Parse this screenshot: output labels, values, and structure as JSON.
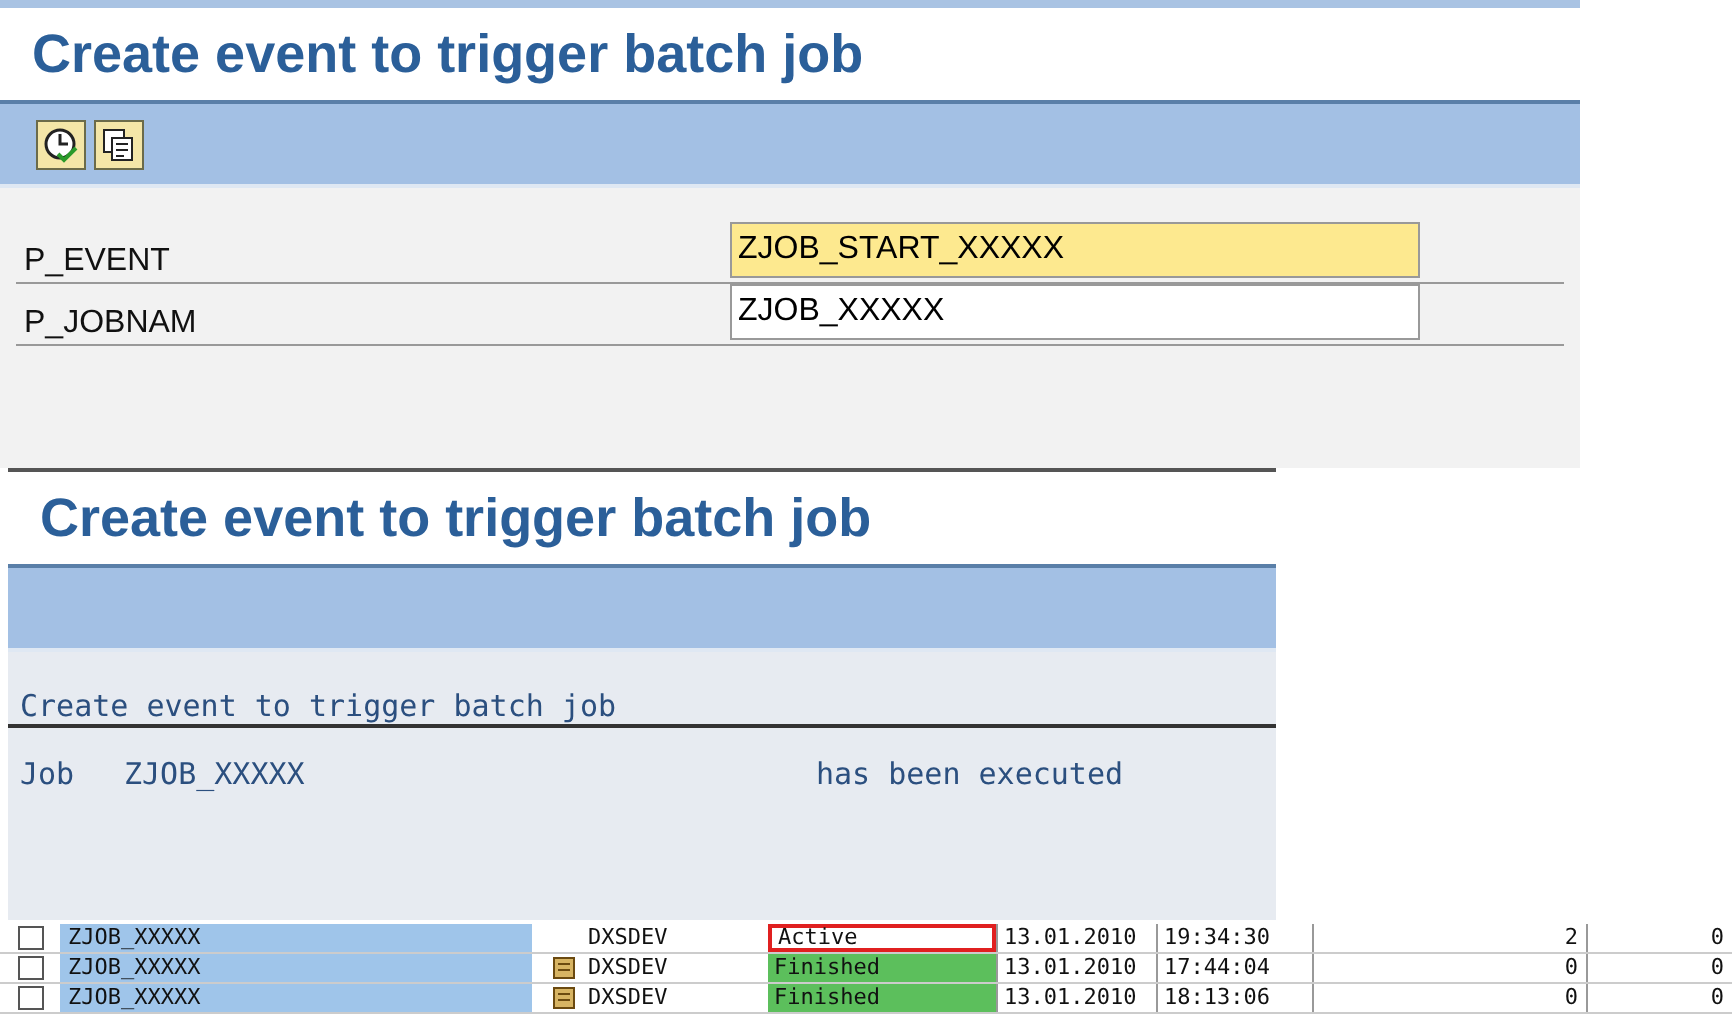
{
  "selection_screen": {
    "title": "Create event to trigger batch job",
    "toolbar": [
      {
        "kind": "execute"
      },
      {
        "kind": "variant"
      }
    ],
    "fields": [
      {
        "label": "P_EVENT",
        "value": "ZJOB_START_XXXXX",
        "focused": true
      },
      {
        "label": "P_JOBNAM",
        "value": "ZJOB_XXXXX",
        "focused": false
      }
    ]
  },
  "result_screen": {
    "title": "Create event to trigger batch job",
    "list_heading": "Create event to trigger batch job",
    "message": {
      "label": "Job",
      "job": "ZJOB_XXXXX",
      "text": "has been executed"
    }
  },
  "job_rows": [
    {
      "checked": false,
      "name": "ZJOB_XXXXX",
      "has_log": false,
      "server": "DXSDEV",
      "status": "Active",
      "kind": "active",
      "highlighted": true,
      "date": "13.01.2010",
      "time": "19:34:30",
      "column_8": "2",
      "column_9": "0"
    },
    {
      "checked": false,
      "name": "ZJOB_XXXXX",
      "has_log": true,
      "server": "DXSDEV",
      "status": "Finished",
      "kind": "finished",
      "highlighted": false,
      "date": "13.01.2010",
      "time": "17:44:04",
      "column_8": "0",
      "column_9": "0"
    },
    {
      "checked": false,
      "name": "ZJOB_XXXXX",
      "has_log": true,
      "server": "DXSDEV",
      "status": "Finished",
      "kind": "finished",
      "highlighted": false,
      "date": "13.01.2010",
      "time": "18:13:06",
      "column_8": "0",
      "column_9": "0"
    }
  ]
}
